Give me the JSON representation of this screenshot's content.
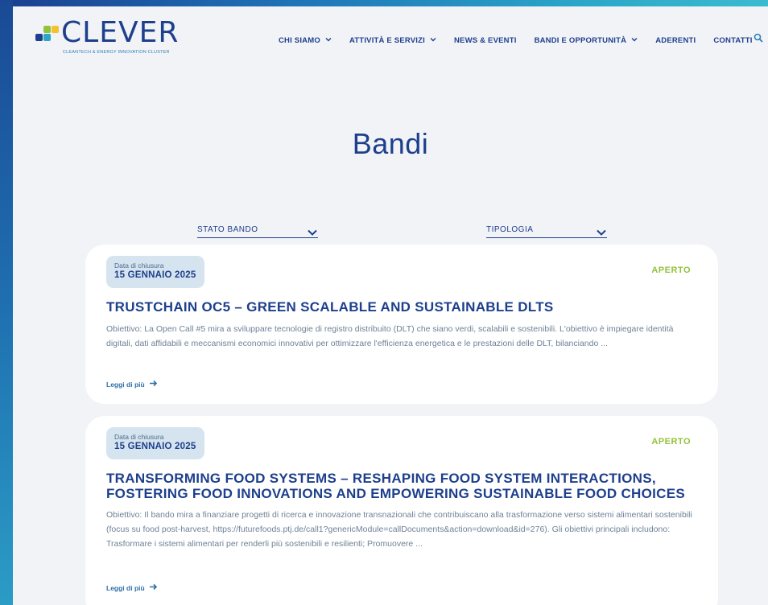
{
  "brand": {
    "name": "CLEVER",
    "tagline": "CLEANTECH & ENERGY INNOVATION CLUSTER",
    "colors": {
      "primary": "#1d3f8c",
      "accent_green": "#93c23b",
      "accent_blue": "#2a7fb8"
    }
  },
  "nav": {
    "items": [
      {
        "label": "CHI SIAMO",
        "dropdown": true
      },
      {
        "label": "ATTIVITÀ E SERVIZI",
        "dropdown": true
      },
      {
        "label": "NEWS & EVENTI",
        "dropdown": false
      },
      {
        "label": "BANDI E OPPORTUNITÀ",
        "dropdown": true
      },
      {
        "label": "ADERENTI",
        "dropdown": false
      },
      {
        "label": "CONTATTI",
        "dropdown": false
      }
    ],
    "search_icon": "search-icon"
  },
  "page": {
    "title": "Bandi"
  },
  "filters": {
    "stato": {
      "label": "STATO BANDO"
    },
    "tipologia": {
      "label": "TIPOLOGIA"
    }
  },
  "cards": [
    {
      "date_label": "Data di chiusura",
      "date_value": "15 GENNAIO 2025",
      "status": "APERTO",
      "title": "TRUSTCHAIN OC5 – GREEN SCALABLE AND SUSTAINABLE DLTS",
      "description": "Obiettivo: La Open Call #5 mira a sviluppare tecnologie di registro distribuito (DLT) che siano verdi, scalabili e sostenibili. L'obiettivo è impiegare identità digitali, dati affidabili e meccanismi economici innovativi per ottimizzare l'efficienza energetica e le prestazioni delle DLT, bilanciando ...",
      "read_more": "Leggi di più"
    },
    {
      "date_label": "Data di chiusura",
      "date_value": "15 GENNAIO 2025",
      "status": "APERTO",
      "title": "TRANSFORMING FOOD SYSTEMS – RESHAPING FOOD SYSTEM INTERACTIONS, FOSTERING FOOD INNOVATIONS AND EMPOWERING SUSTAINABLE FOOD CHOICES",
      "description": "Obiettivo: Il bando mira a finanziare progetti di ricerca e innovazione transnazionali che contribuiscano alla trasformazione verso sistemi alimentari sostenibili (focus su food post-harvest, https://futurefoods.ptj.de/call1?genericModule=callDocuments&action=download&id=276). Gli obiettivi principali includono: Trasformare i sistemi alimentari per renderli più sostenibili e resilienti; Promuovere ...",
      "read_more": "Leggi di più"
    }
  ]
}
